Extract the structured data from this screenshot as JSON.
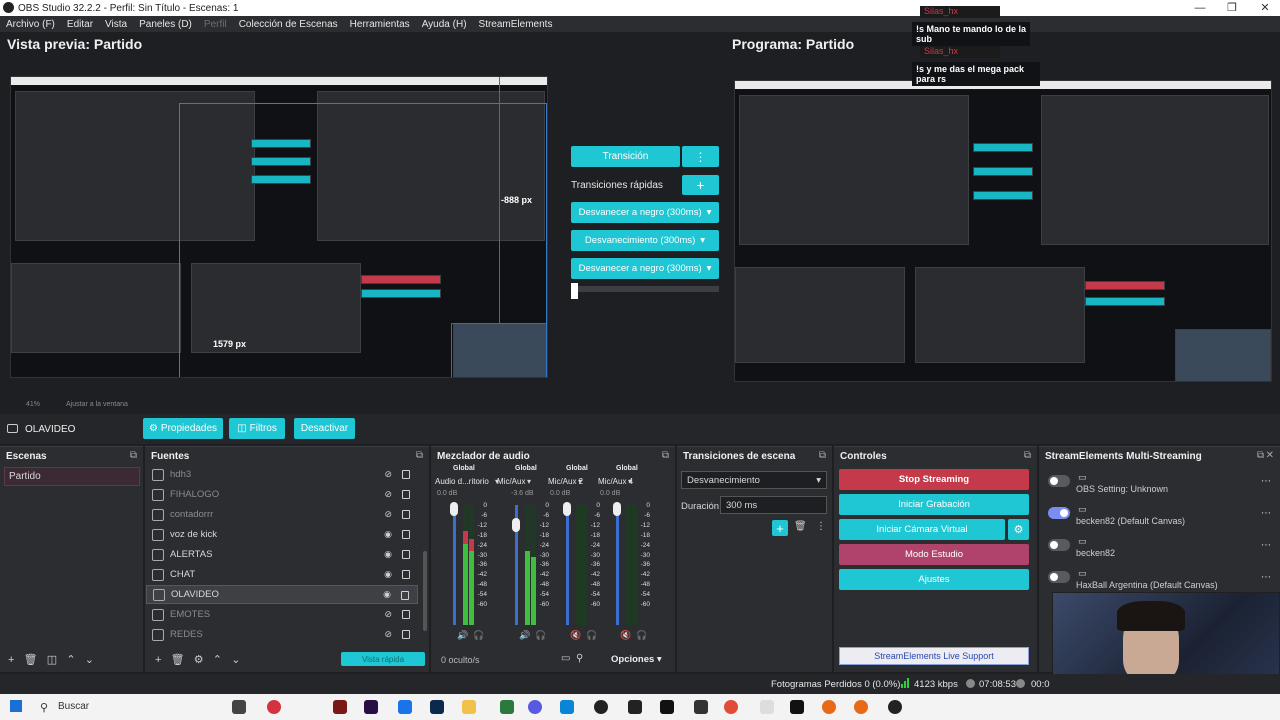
{
  "window": {
    "title": "OBS Studio 32.2.2 - Perfil: Sin Título - Escenas: 1",
    "min": "—",
    "max": "❐",
    "close": "✕"
  },
  "menu": [
    {
      "label": "Archivo (F)",
      "dim": false
    },
    {
      "label": "Editar",
      "dim": false
    },
    {
      "label": "Vista",
      "dim": false
    },
    {
      "label": "Paneles (D)",
      "dim": false
    },
    {
      "label": "Perfil",
      "dim": true
    },
    {
      "label": "Colección de Escenas",
      "dim": false
    },
    {
      "label": "Herramientas",
      "dim": false
    },
    {
      "label": "Ayuda (H)",
      "dim": false
    },
    {
      "label": "StreamElements",
      "dim": false
    }
  ],
  "preview": {
    "title": "Vista previa: Partido",
    "dim_width": "-888 px",
    "dim_height": "1579 px",
    "zoom": "41%",
    "fit": "Ajustar a la ventana"
  },
  "program": {
    "title": "Programa: Partido"
  },
  "transition_panel": {
    "transition_btn": "Transición",
    "quick_label": "Transiciones rápidas",
    "quick": [
      "Desvanecer a negro (300ms)",
      "Desvanecimiento (300ms)",
      "Desvanecer a negro (300ms)"
    ]
  },
  "chat": [
    {
      "user": "Silas_hx",
      "message": "!s Mano te mando lo de la sub"
    },
    {
      "user": "Silas_hx",
      "message": "!s y me das el mega pack para rs"
    }
  ],
  "source_toolbar": {
    "name": "OLAVIDEO",
    "props": "Propiedades",
    "filters": "Filtros",
    "deactivate": "Desactivar"
  },
  "scenes": {
    "title": "Escenas",
    "items": [
      "Partido"
    ]
  },
  "sources": {
    "title": "Fuentes",
    "items": [
      {
        "name": "hdh3",
        "dim": true,
        "visible": false
      },
      {
        "name": "FIHALOGO",
        "dim": true,
        "visible": false
      },
      {
        "name": "contadorrr",
        "dim": true,
        "visible": false
      },
      {
        "name": "voz de kick",
        "dim": false,
        "visible": true
      },
      {
        "name": "ALERTAS",
        "dim": false,
        "visible": true
      },
      {
        "name": "CHAT",
        "dim": false,
        "visible": true
      },
      {
        "name": "OLAVIDEO",
        "dim": false,
        "visible": true
      },
      {
        "name": "EMOTES",
        "dim": true,
        "visible": false
      },
      {
        "name": "REDES",
        "dim": true,
        "visible": false
      }
    ]
  },
  "mixer": {
    "title": "Mezclador de audio",
    "channels": [
      {
        "group": "Global",
        "name": "Audio d...ritorio",
        "db": "0.0 dB",
        "level": 0.78,
        "red": true,
        "muted": false
      },
      {
        "group": "Global",
        "name": "Mic/Aux",
        "db": "-3.6 dB",
        "level": 0.62,
        "red": false,
        "muted": false
      },
      {
        "group": "Global",
        "name": "Mic/Aux 2",
        "db": "0.0 dB",
        "level": 0.0,
        "red": false,
        "muted": true
      },
      {
        "group": "Global",
        "name": "Mic/Aux 4",
        "db": "0.0 dB",
        "level": 0.0,
        "red": false,
        "muted": true
      }
    ],
    "ticks": [
      "0",
      "-6",
      "-12",
      "-18",
      "-24",
      "-30",
      "-36",
      "-42",
      "-48",
      "-54",
      "-60"
    ],
    "hidden": "0 oculto/s",
    "options": "Opciones"
  },
  "scene_transitions": {
    "title": "Transiciones de escena",
    "selected": "Desvanecimiento",
    "duration_label": "Duración",
    "duration": "300 ms"
  },
  "controls": {
    "title": "Controles",
    "stop_streaming": "Stop Streaming",
    "start_recording": "Iniciar Grabación",
    "virtual_cam": "Iniciar Cámara Virtual",
    "studio_mode": "Modo Estudio",
    "settings": "Ajustes",
    "support": "StreamElements Live Support",
    "colors": {
      "stop": "#c43a4a",
      "teal": "#1fc7d4",
      "studio": "#b0436b"
    }
  },
  "se": {
    "title": "StreamElements Multi-Streaming",
    "rows": [
      {
        "label": "OBS Setting: Unknown",
        "on": false
      },
      {
        "label": "becken82 (Default Canvas)",
        "on": true
      },
      {
        "label": "becken82",
        "on": false
      },
      {
        "label": "HaxBall Argentina (Default Canvas)",
        "on": false
      }
    ]
  },
  "status": {
    "frames": "Fotogramas Perdidos 0 (0.0%)",
    "kbps": "4123 kbps",
    "time": "07:08:53",
    "cut": "00:0"
  },
  "taskbar": {
    "search": "Buscar"
  },
  "dimmed_button": "Vista rápida"
}
